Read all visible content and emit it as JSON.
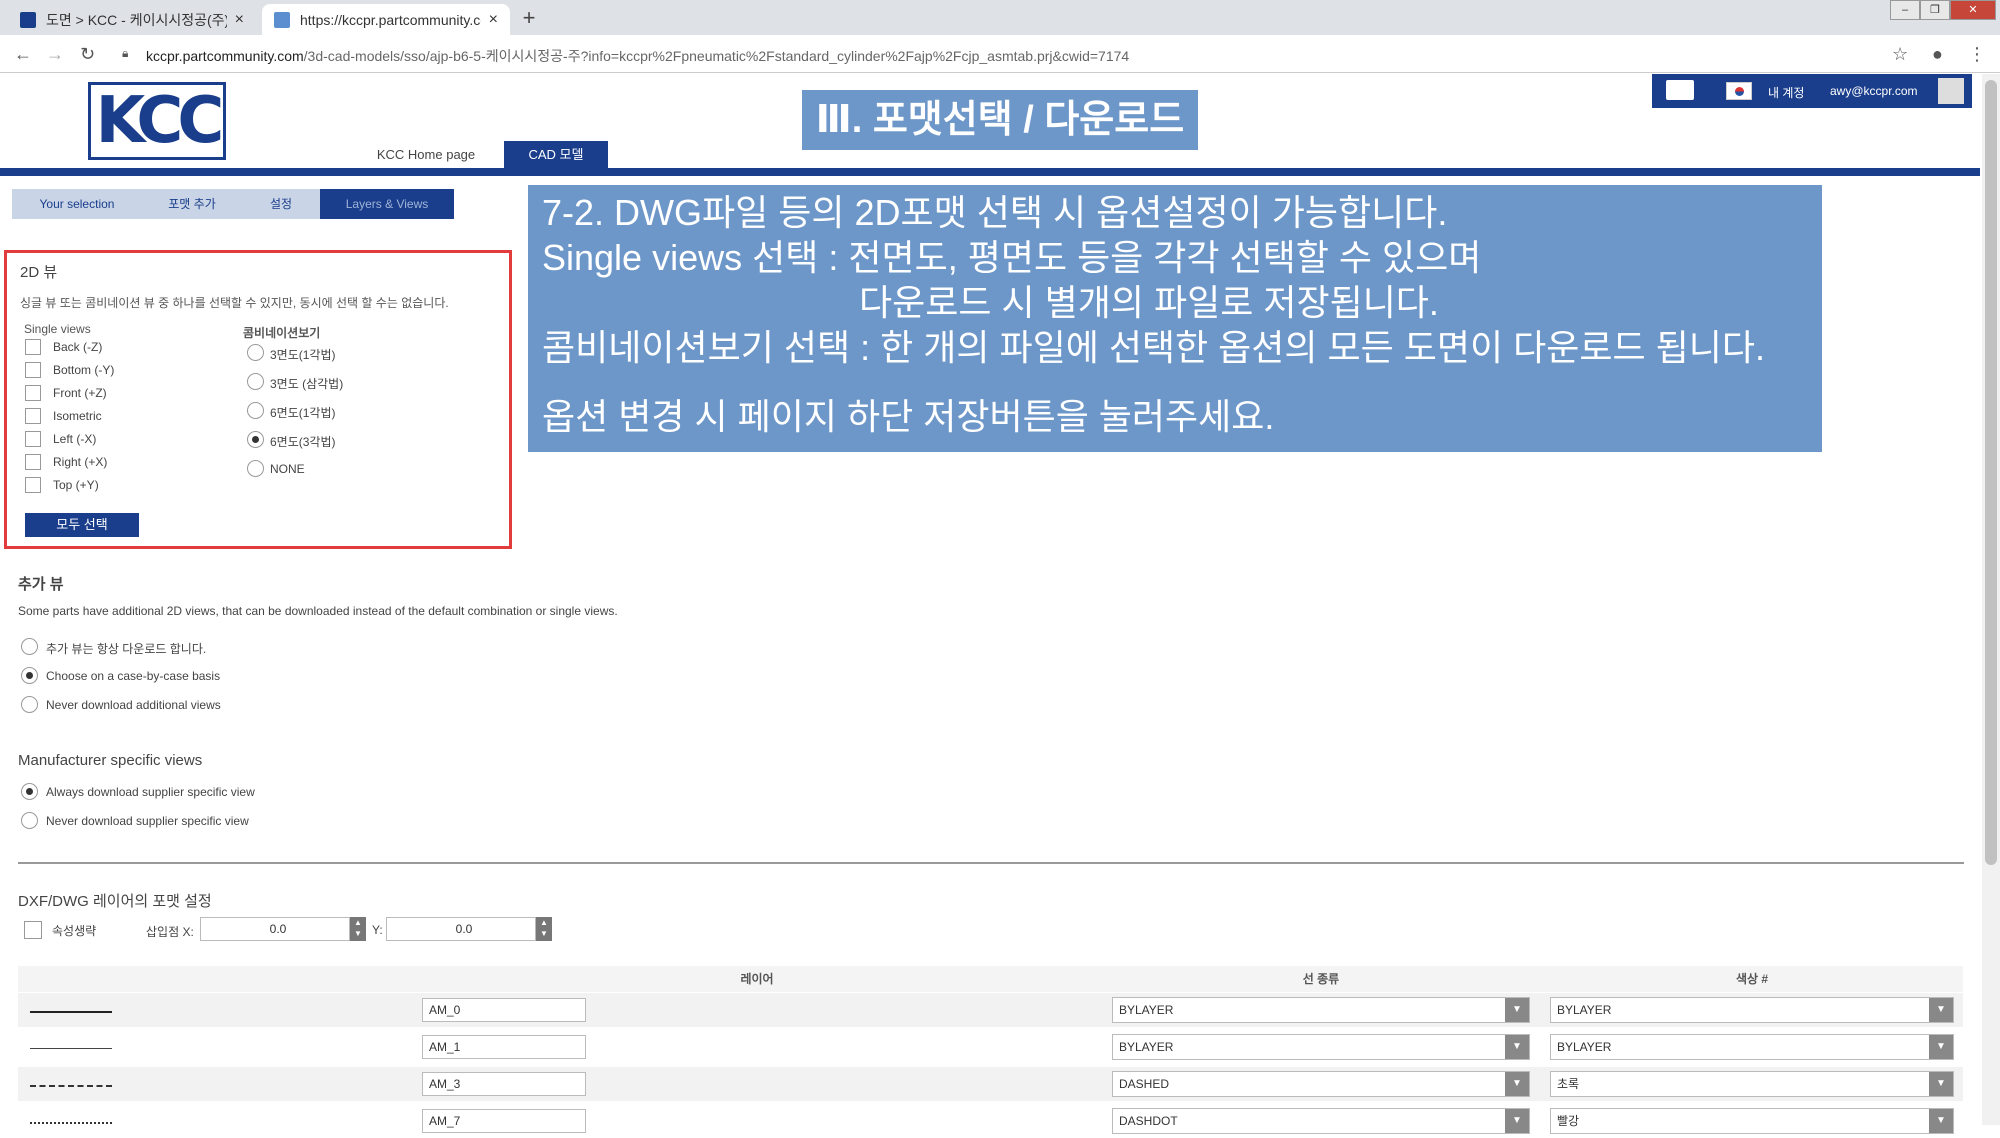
{
  "browser": {
    "tabs": [
      {
        "label": "도면 > KCC - 케이시시정공(주)",
        "active": false
      },
      {
        "label": "https://kccpr.partcommunity.co",
        "active": true
      }
    ],
    "new_tab": "+",
    "close_glyph": "×",
    "url_host": "kccpr.partcommunity.com",
    "url_path": "/3d-cad-models/sso/ajp-b6-5-케이시시정공-주?info=kccpr%2Fpneumatic%2Fstandard_cylinder%2Fajp%2Fcjp_asmtab.prj&cwid=7174"
  },
  "site": {
    "logo": "KCC",
    "title": "Ⅲ. 포맷선택 / 다운로드",
    "nav": [
      "KCC Home page",
      "CAD 모델"
    ],
    "account_label": "내 계정",
    "account_email": "awy@kccpr.com"
  },
  "subtabs": [
    "Your selection",
    "포맷 추가",
    "설정",
    "Layers & Views"
  ],
  "panel2d": {
    "title": "2D 뷰",
    "desc": "싱글 뷰 또는 콤비네이션 뷰 중 하나를 선택할 수 있지만, 동시에 선택 할 수는 없습니다.",
    "single_title": "Single views",
    "single_views": [
      "Back (-Z)",
      "Bottom (-Y)",
      "Front (+Z)",
      "Isometric",
      "Left (-X)",
      "Right (+X)",
      "Top (+Y)"
    ],
    "combo_title": "콤비네이션보기",
    "combos": [
      {
        "label": "3면도(1각법)",
        "selected": false
      },
      {
        "label": "3면도 (삼각법)",
        "selected": false
      },
      {
        "label": "6면도(1각법)",
        "selected": false
      },
      {
        "label": "6면도(3각법)",
        "selected": true
      },
      {
        "label": "NONE",
        "selected": false
      }
    ],
    "select_all": "모두 선택"
  },
  "info": {
    "lines": [
      "7-2. DWG파일 등의 2D포맷 선택 시 옵션설정이 가능합니다.",
      "Single views 선택 : 전면도, 평면도 등을 각각 선택할 수 있으며",
      "다운로드 시 별개의 파일로 저장됩니다.",
      "콤비네이션보기 선택 : 한 개의 파일에 선택한 옵션의 모든 도면이 다운로드 됩니다.",
      "옵션 변경 시 페이지 하단 저장버튼을 눌러주세요."
    ]
  },
  "extra_views": {
    "title": "추가 뷰",
    "desc": "Some parts have additional 2D views, that can be downloaded instead of the default combination or single views.",
    "options": [
      {
        "label": "추가 뷰는 항상 다운로드 합니다.",
        "selected": false
      },
      {
        "label": "Choose on a case-by-case basis",
        "selected": true
      },
      {
        "label": "Never download additional views",
        "selected": false
      }
    ]
  },
  "manufacturer": {
    "title": "Manufacturer specific views",
    "options": [
      {
        "label": "Always download supplier specific view",
        "selected": true
      },
      {
        "label": "Never download supplier specific view",
        "selected": false
      }
    ]
  },
  "layers": {
    "title": "DXF/DWG 레이어의 포맷 설정",
    "attr_label": "속성생략",
    "insert_label": "삽입점 X:",
    "x_value": "0.0",
    "y_label": "Y:",
    "y_value": "0.0",
    "headers": [
      "레이어",
      "선 종류",
      "색상 #"
    ],
    "rows": [
      {
        "line": "solid",
        "layer": "AM_0",
        "linetype": "BYLAYER",
        "color": "BYLAYER"
      },
      {
        "line": "thin",
        "layer": "AM_1",
        "linetype": "BYLAYER",
        "color": "BYLAYER"
      },
      {
        "line": "dashed",
        "layer": "AM_3",
        "linetype": "DASHED",
        "color": "초록"
      },
      {
        "line": "dashdot",
        "layer": "AM_7",
        "linetype": "DASHDOT",
        "color": "빨강"
      }
    ]
  }
}
